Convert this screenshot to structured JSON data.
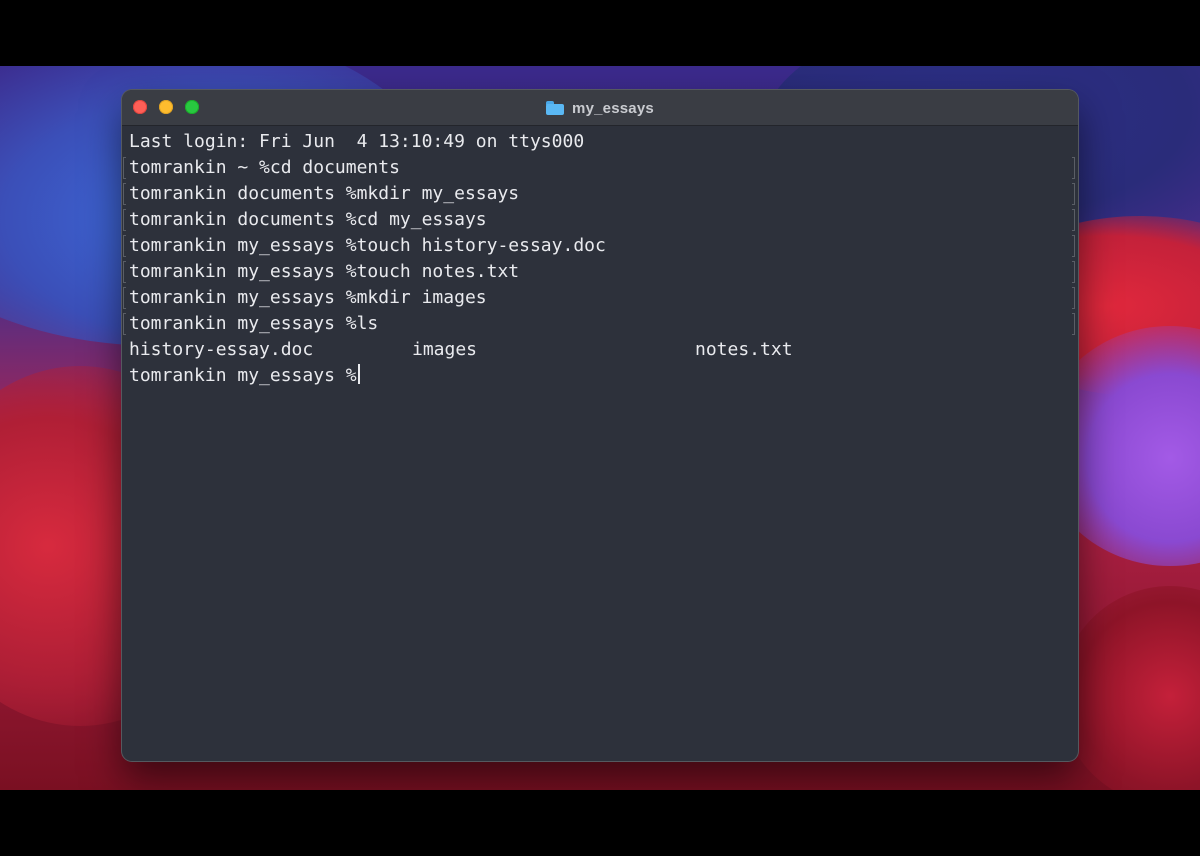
{
  "window": {
    "title": "my_essays",
    "title_icon": "folder-icon"
  },
  "terminal": {
    "login": "Last login: Fri Jun  4 13:10:49 on ttys000",
    "commands": [
      "tomrankin ~ %cd documents",
      "tomrankin documents %mkdir my_essays",
      "tomrankin documents %cd my_essays",
      "tomrankin my_essays %touch history-essay.doc",
      "tomrankin my_essays %touch notes.txt",
      "tomrankin my_essays %mkdir images",
      "tomrankin my_essays %ls"
    ],
    "ls_output": [
      "history-essay.doc",
      "images",
      "notes.txt"
    ],
    "prompt": "tomrankin my_essays %"
  },
  "colors": {
    "terminal_bg": "#2d313b",
    "titlebar_bg": "#3a3d44",
    "text": "#e9eaee",
    "close": "#fe5f57",
    "minimize": "#febc2e",
    "zoom": "#28c840"
  }
}
